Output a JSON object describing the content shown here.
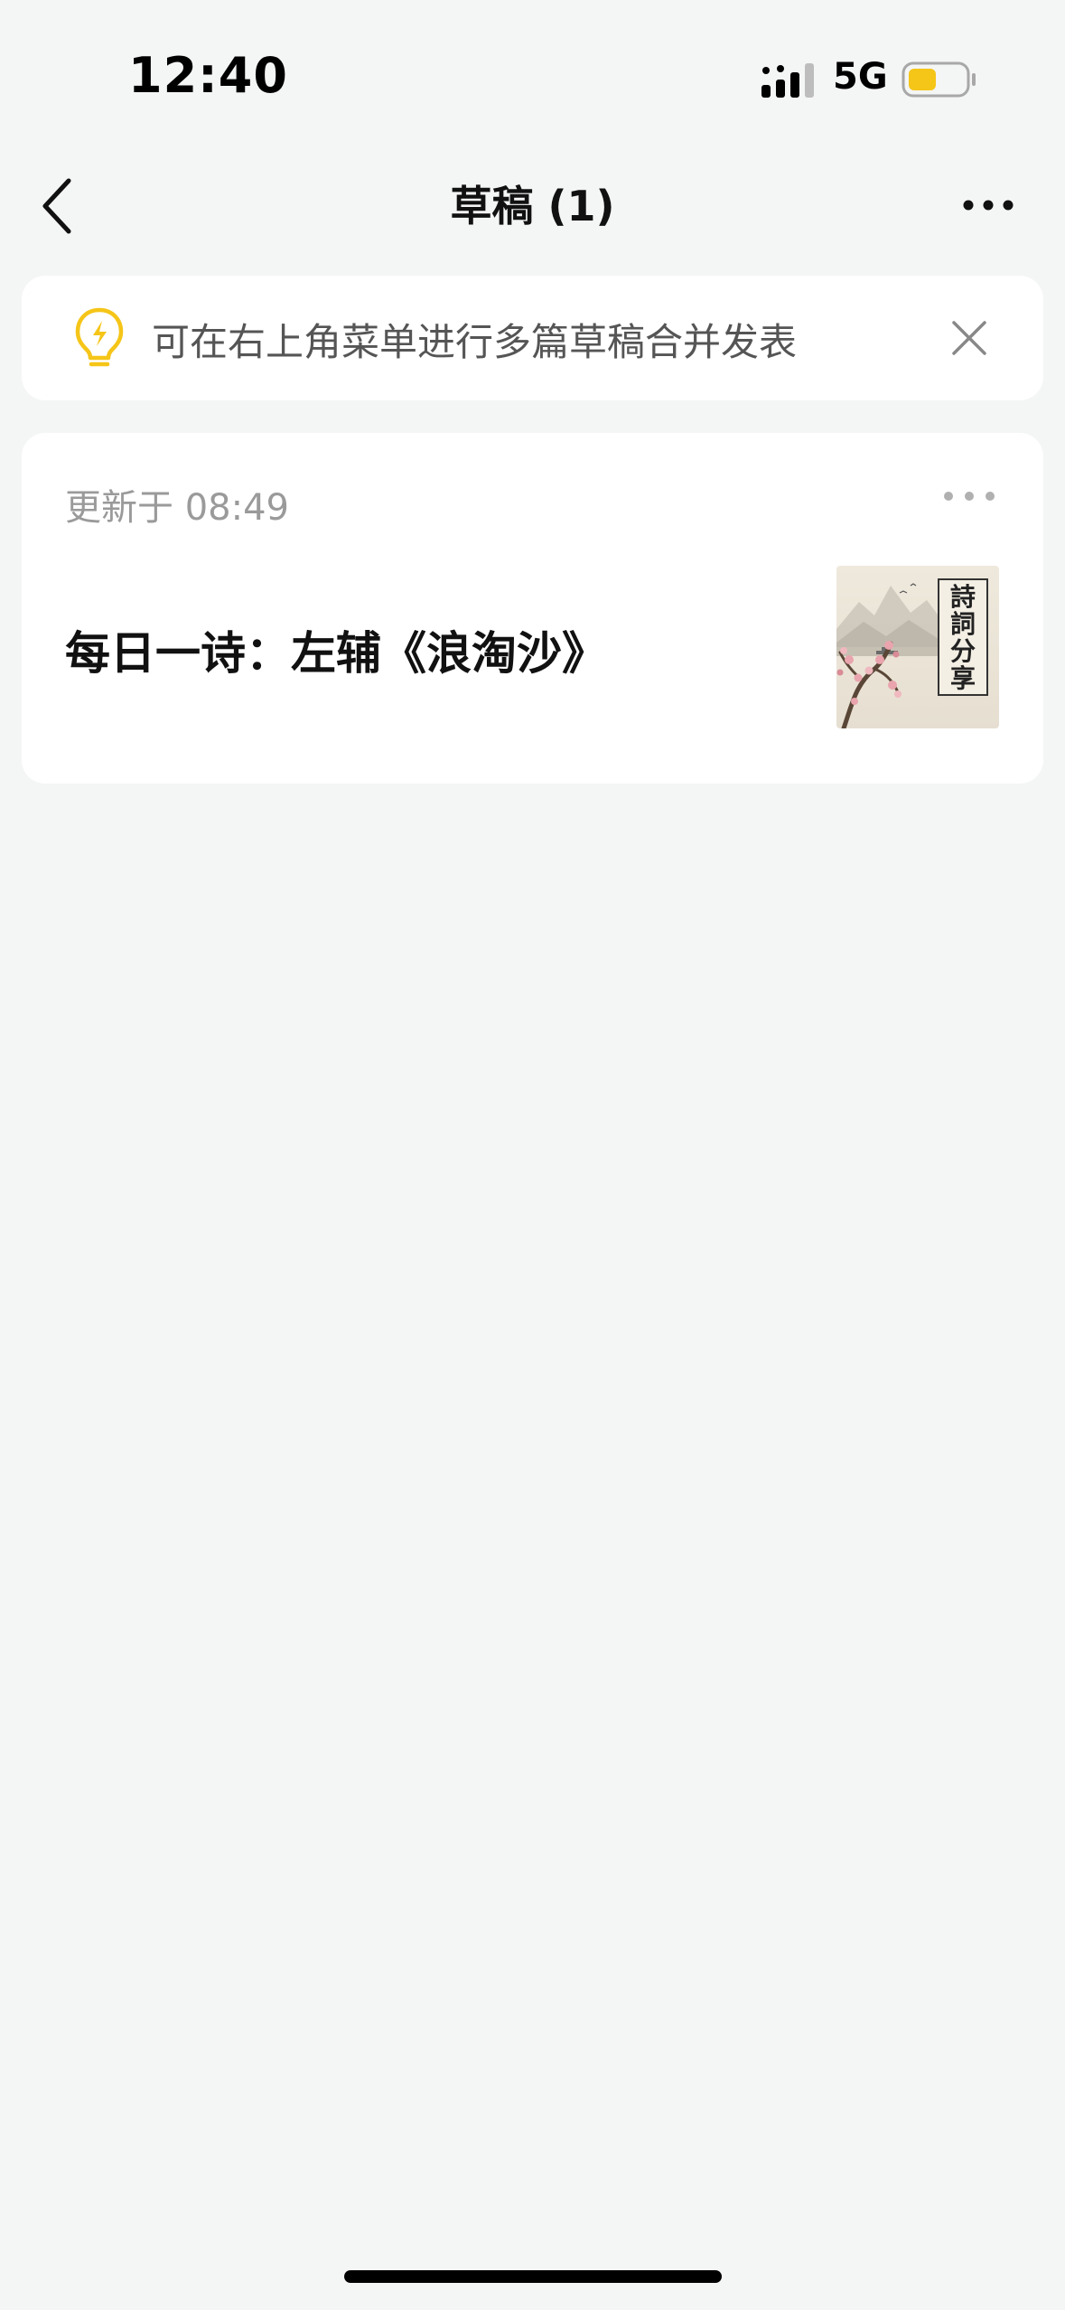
{
  "status_bar": {
    "time": "12:40",
    "network": "5G",
    "battery_color": "#f5c518"
  },
  "nav": {
    "title": "草稿 (1)",
    "back_icon": "chevron-left-icon",
    "more_icon": "more-horizontal-icon"
  },
  "tip": {
    "icon": "lightbulb-icon",
    "icon_color": "#f5c518",
    "text": "可在右上角菜单进行多篇草稿合并发表",
    "close_icon": "close-icon"
  },
  "drafts": [
    {
      "updated": "更新于 08:49",
      "title": "每日一诗：左辅《浪淘沙》",
      "thumbnail": {
        "icon": "poetry-share-thumbnail",
        "caption_chars": [
          "詩",
          "詞",
          "分",
          "享"
        ]
      },
      "more_icon": "more-horizontal-icon"
    }
  ]
}
